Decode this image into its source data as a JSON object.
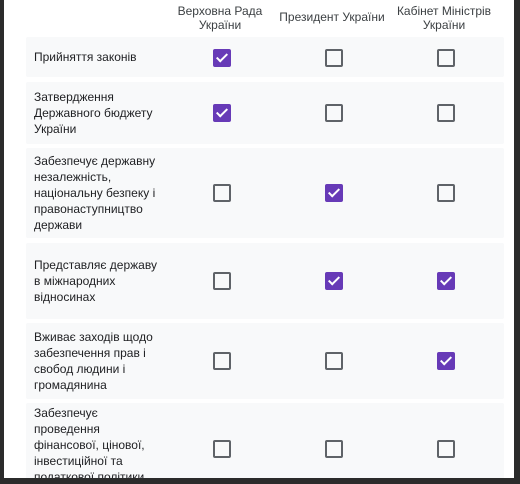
{
  "columns": [
    "Верховна Рада України",
    "Президент України",
    "Кабінет Міністрів України"
  ],
  "rows": [
    {
      "label": "Прийняття законів",
      "checked": [
        true,
        false,
        false
      ]
    },
    {
      "label": "Затвердження Державного бюджету України",
      "checked": [
        true,
        false,
        false
      ]
    },
    {
      "label": "Забезпечує державну незалежність, національну безпеку і правонаступництво держави",
      "checked": [
        false,
        true,
        false
      ]
    },
    {
      "label": "Представляє державу в міжнародних відносинах",
      "checked": [
        false,
        true,
        true
      ]
    },
    {
      "label": "Вживає заходів щодо забезпечення прав і свобод людини і громадянина",
      "checked": [
        false,
        false,
        true
      ]
    },
    {
      "label": "Забезпечує проведення фінансової, цінової, інвестиційної та податкової політики",
      "checked": [
        false,
        false,
        false
      ]
    }
  ],
  "colors": {
    "accent": "#673ab7",
    "row_bg": "#f8f9fa",
    "checkbox_border": "#5f6368"
  }
}
